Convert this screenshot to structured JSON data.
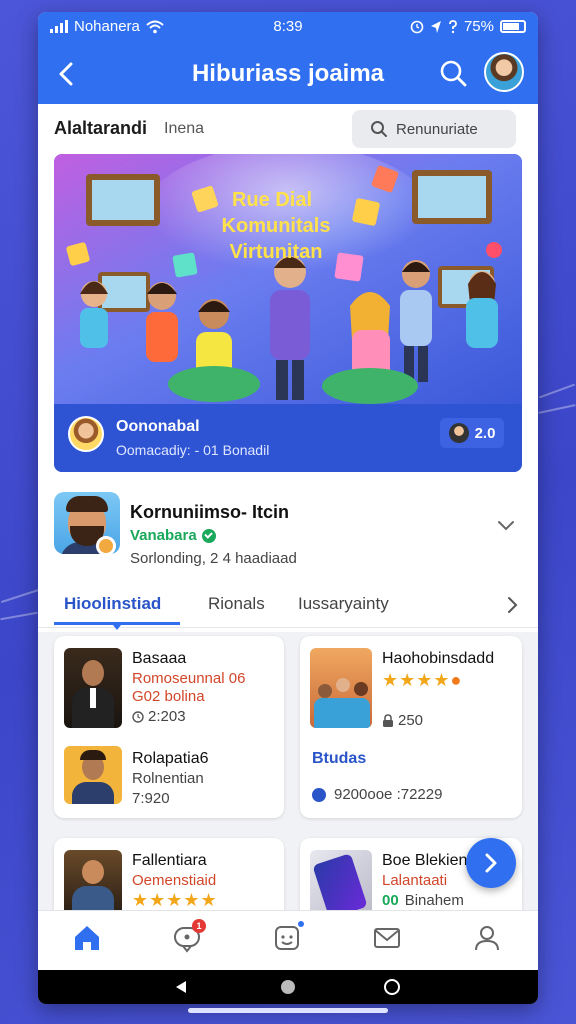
{
  "status_bar": {
    "carrier": "Nohanera",
    "time": "8:39",
    "battery": "75%"
  },
  "header": {
    "title": "Hiburiass joaima"
  },
  "filter": {
    "primary": "Alaltarandi",
    "secondary": "Inena",
    "search_placeholder": "Renunuriate"
  },
  "hero": {
    "banner_text": [
      "Rue Dial",
      "Komunitals",
      "Virtunitan"
    ],
    "host_name": "Oononabal",
    "host_sub": "Oomacadiy: - 01 Bonadil",
    "viewer_count": "2.0"
  },
  "community": {
    "name": "Kornuniimso- Itcin",
    "type": "Vanabara",
    "sub": "Sorlonding, 2 4 haadiaad"
  },
  "tabs": [
    "Hioolinstiad",
    "Rionals",
    "Iussaryainty"
  ],
  "cards": [
    {
      "title": "Basaaa",
      "red": "Romoseunnal 06",
      "red2": "G02 bolina",
      "meta": "2:203"
    },
    {
      "title": "Haohobinsdadd",
      "meta": "250",
      "link": "Btudas",
      "foot": "9200ooe :72229"
    },
    {
      "title": "Rolapatia6",
      "sub": "Rolnentian",
      "meta": "7:920"
    },
    {
      "title": "Fallentiara",
      "red": "Oemenstiaid"
    },
    {
      "title": "Boe Blekien",
      "red": "Lalantaati",
      "sub": "Binahem",
      "sub_prefix": "00"
    }
  ],
  "colors": {
    "primary": "#2f6ff0",
    "accent_red": "#d2462a",
    "accent_green": "#1aa85a",
    "star": "#f2a71b"
  }
}
